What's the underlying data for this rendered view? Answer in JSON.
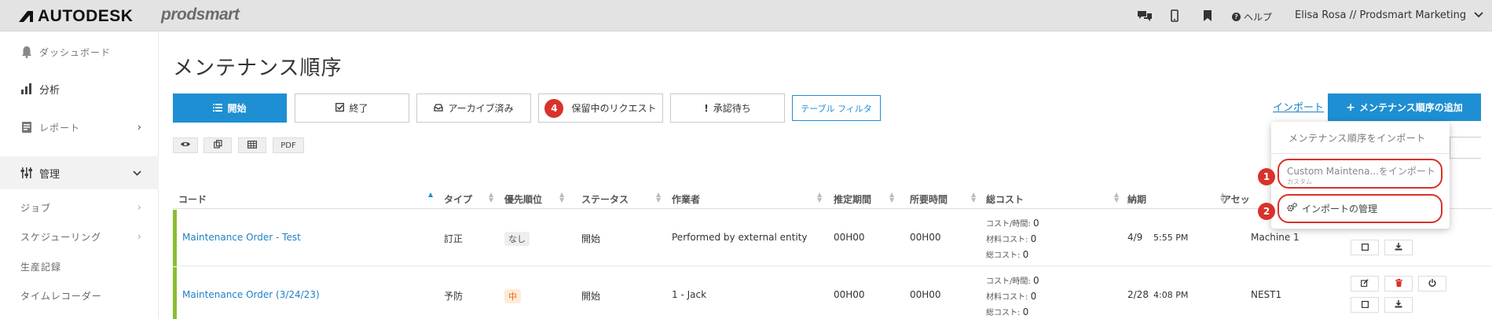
{
  "topbar": {
    "brand": "AUTODESK",
    "product": "prodsmart",
    "help_label": "ヘルプ",
    "user_label": "Elisa Rosa // Prodsmart Marketing",
    "icons": [
      "chat-icon",
      "mobile-icon",
      "bookmark-icon",
      "help-icon",
      "chevron-down-icon"
    ]
  },
  "sidebar": {
    "items": [
      {
        "label": "ダッシュボード",
        "icon": "bell-icon"
      },
      {
        "label": "分析",
        "icon": "bar-chart-icon"
      },
      {
        "label": "レポート",
        "icon": "report-icon"
      },
      {
        "label": "管理",
        "icon": "sliders-icon"
      },
      {
        "label": "ジョブ"
      },
      {
        "label": "スケジューリング"
      },
      {
        "label": "生産記録"
      },
      {
        "label": "タイムレコーダー"
      }
    ]
  },
  "main": {
    "title": "メンテナンス順序",
    "tabs": [
      {
        "label": "開始",
        "icon": "list-icon"
      },
      {
        "label": "終了",
        "icon": "check-square-icon"
      },
      {
        "label": "アーカイブ済み",
        "icon": "inbox-icon"
      },
      {
        "label": "保留中のリクエスト",
        "badge": "4"
      },
      {
        "label": "承認待ち",
        "icon": "exclamation-icon"
      }
    ],
    "filter_label": "テーブル フィルタ",
    "mini_buttons": [
      "eye-icon",
      "copy-icon",
      "table-icon",
      "PDF"
    ],
    "import_link": "インポート",
    "add_button": "メンテナンス順序の追加"
  },
  "dropdown": {
    "header": "メンテナンス順序をインポート",
    "item1_title": "Custom Maintena...をインポート",
    "item1_sub": "カスタム",
    "item2_label": "インポートの管理",
    "callouts": [
      "1",
      "2"
    ]
  },
  "table": {
    "columns": [
      "コード",
      "タイプ",
      "優先順位",
      "ステータス",
      "作業者",
      "推定期間",
      "所要時間",
      "総コスト",
      "納期",
      "アセッ"
    ],
    "cost_labels": [
      "コスト/時間:",
      "材料コスト:",
      "総コスト:"
    ],
    "rows": [
      {
        "code": "Maintenance Order - Test",
        "type": "訂正",
        "priority": "なし",
        "status": "開始",
        "operator": "Performed by external entity",
        "estimated": "00H00",
        "elapsed": "00H00",
        "cost_hour": "0",
        "material": "0",
        "total": "0",
        "due_date": "4/9",
        "due_time": "5:55 PM",
        "asset": "Machine 1"
      },
      {
        "code": "Maintenance Order (3/24/23)",
        "type": "予防",
        "priority": "中",
        "status": "開始",
        "operator": "1 - Jack",
        "estimated": "00H00",
        "elapsed": "00H00",
        "cost_hour": "0",
        "material": "0",
        "total": "0",
        "due_date": "2/28",
        "due_time": "4:08 PM",
        "asset": "NEST1"
      }
    ]
  },
  "colors": {
    "accent": "#1e8fd3",
    "callout": "#d9322b",
    "row_bar": "#8bbd32",
    "priority_medium": "#e36c0a"
  }
}
